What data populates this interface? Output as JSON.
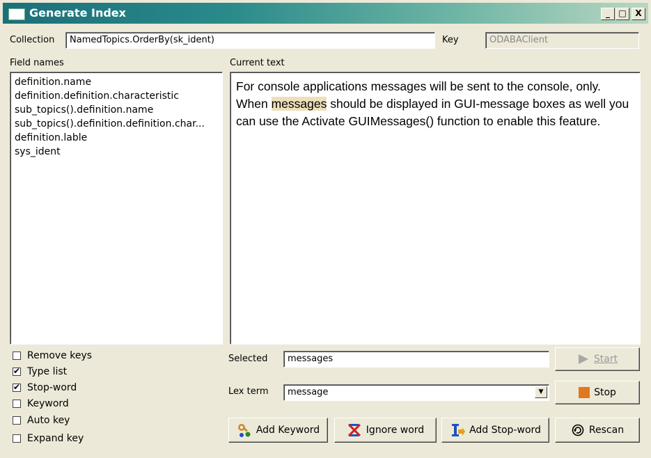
{
  "window": {
    "title": "Generate Index",
    "controls": [
      "_",
      "□",
      "X"
    ]
  },
  "collection": {
    "label": "Collection",
    "value": "NamedTopics.OrderBy(sk_ident)"
  },
  "key": {
    "label": "Key",
    "value": "ODABAClient"
  },
  "field_names": {
    "label": "Field names",
    "items": [
      "definition.name",
      "definition.definition.characteristic",
      "sub_topics().definition.name",
      "sub_topics().definition.definition.char...",
      "definition.lable",
      "sys_ident"
    ]
  },
  "current_text": {
    "label": "Current text",
    "before": "For console applications messages will be sent to the console, only. When ",
    "highlight": "messages",
    "after": " should be displayed in GUI-message boxes as well you can use the Activate GUIMessages() function to enable this feature."
  },
  "options": [
    {
      "label": "Remove keys",
      "checked": false
    },
    {
      "label": "Type list",
      "checked": true
    },
    {
      "label": "Stop-word",
      "checked": true
    },
    {
      "label": "Keyword",
      "checked": false
    },
    {
      "label": "Auto key",
      "checked": false
    },
    {
      "label": "Expand key",
      "checked": false
    }
  ],
  "selected": {
    "label": "Selected",
    "value": "messages"
  },
  "lex_term": {
    "label": "Lex term",
    "value": "message"
  },
  "buttons": {
    "start": "Start",
    "stop": "Stop",
    "add_keyword": "Add Keyword",
    "ignore_word": "Ignore word",
    "add_stop_word": "Add Stop-word",
    "rescan": "Rescan"
  },
  "colors": {
    "stop_icon": "#e07820",
    "highlight": "#ede0b8",
    "title_gradient_start": "#1c6f7a"
  }
}
